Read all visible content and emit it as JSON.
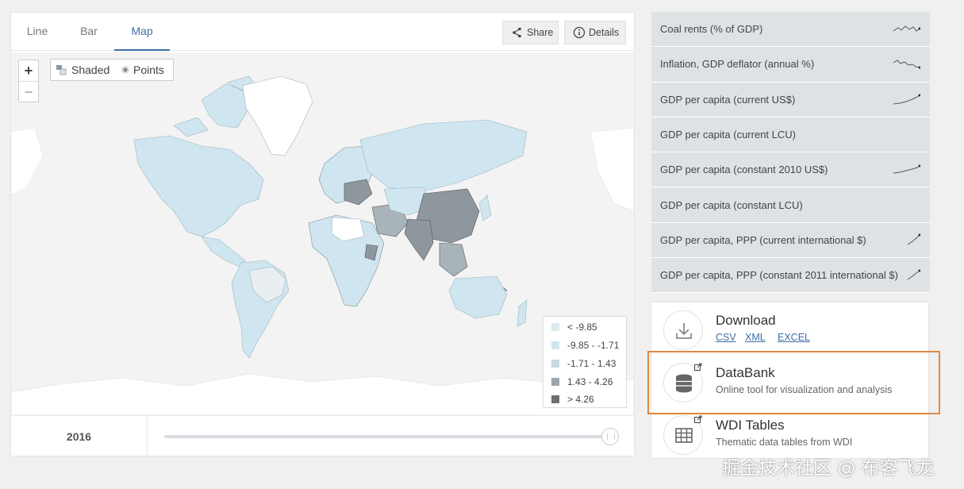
{
  "tabs": [
    {
      "label": "Line"
    },
    {
      "label": "Bar"
    },
    {
      "label": "Map",
      "active": true
    }
  ],
  "toolbar": {
    "share_label": "Share",
    "details_label": "Details"
  },
  "map": {
    "zoom_in": "+",
    "zoom_out": "−",
    "mode_shaded": "Shaded",
    "mode_points": "Points",
    "legend": [
      {
        "label": "< -9.85",
        "color": "#dde8ef"
      },
      {
        "label": "-9.85 - -1.71",
        "color": "#d3e6ef"
      },
      {
        "label": "-1.71 - 1.43",
        "color": "#c9d8e2"
      },
      {
        "label": "1.43 - 4.26",
        "color": "#9aa6af"
      },
      {
        "label": "> 4.26",
        "color": "#6c6f73"
      }
    ]
  },
  "timeline": {
    "year": "2016",
    "position": 1.0
  },
  "indicators": [
    {
      "label": "Coal rents (% of GDP)"
    },
    {
      "label": "Inflation, GDP deflator (annual %)"
    },
    {
      "label": "GDP per capita (current US$)"
    },
    {
      "label": "GDP per capita (current LCU)"
    },
    {
      "label": "GDP per capita (constant 2010 US$)"
    },
    {
      "label": "GDP per capita (constant LCU)"
    },
    {
      "label": "GDP per capita, PPP (current international $)"
    },
    {
      "label": "GDP per capita, PPP (constant 2011 international $)"
    }
  ],
  "download": {
    "title": "Download",
    "links": [
      "CSV",
      "XML",
      "EXCEL"
    ]
  },
  "databank": {
    "title": "DataBank",
    "subtitle": "Online tool for visualization and analysis"
  },
  "wdi": {
    "title": "WDI Tables",
    "subtitle": "Thematic data tables from WDI"
  },
  "watermark": "掘金技术社区 @ 布客飞龙",
  "colors": {
    "accent": "#3d6fa5",
    "highlight": "#e0883f",
    "map_land": "#cfe5ef",
    "map_dark": "#8e979e"
  }
}
